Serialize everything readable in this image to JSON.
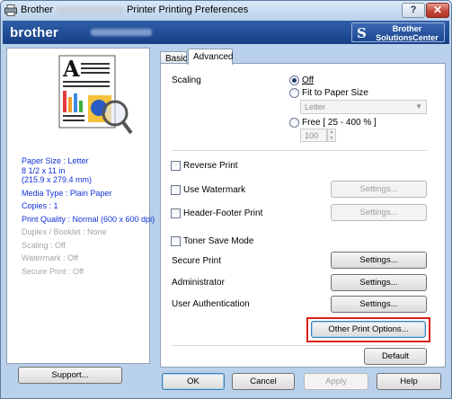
{
  "window": {
    "title_prefix": "Brother",
    "title_suffix": "Printer Printing Preferences",
    "help_symbol": "?",
    "close_symbol": "✕"
  },
  "header": {
    "logo": "brother",
    "solutions_center": [
      "Brother",
      "SolutionsCenter"
    ]
  },
  "tabs": [
    "Basic",
    "Advanced"
  ],
  "summary": {
    "active": [
      "Paper Size : Letter",
      "8 1/2 x 11 in",
      "(215.9 x 279.4 mm)",
      "Media Type : Plain Paper",
      "Copies : 1",
      "Print Quality : Normal (600 x 600 dpi)"
    ],
    "inactive": [
      "Duplex / Booklet : None",
      "Scaling : Off",
      "Watermark : Off",
      "Secure Print : Off"
    ]
  },
  "support_label": "Support...",
  "scaling": {
    "label": "Scaling",
    "off_label": "Off",
    "fit_label": "Fit to Paper Size",
    "fit_value": "Letter",
    "free_label": "Free [ 25 - 400 % ]",
    "free_value": "100",
    "selected": "Off"
  },
  "options": {
    "reverse_print": "Reverse Print",
    "use_watermark": "Use Watermark",
    "header_footer": "Header-Footer Print",
    "toner_save": "Toner Save Mode",
    "secure_print": "Secure Print",
    "administrator": "Administrator",
    "user_auth": "User Authentication"
  },
  "buttons": {
    "settings": "Settings...",
    "other_options": "Other Print Options...",
    "default": "Default",
    "ok": "OK",
    "cancel": "Cancel",
    "apply": "Apply",
    "help": "Help"
  },
  "colors": {
    "title_bar": "#b9d1ea",
    "brand_blue": "#1b4690",
    "highlight_red": "#d8211a",
    "summary_blue": "#1130d6"
  }
}
